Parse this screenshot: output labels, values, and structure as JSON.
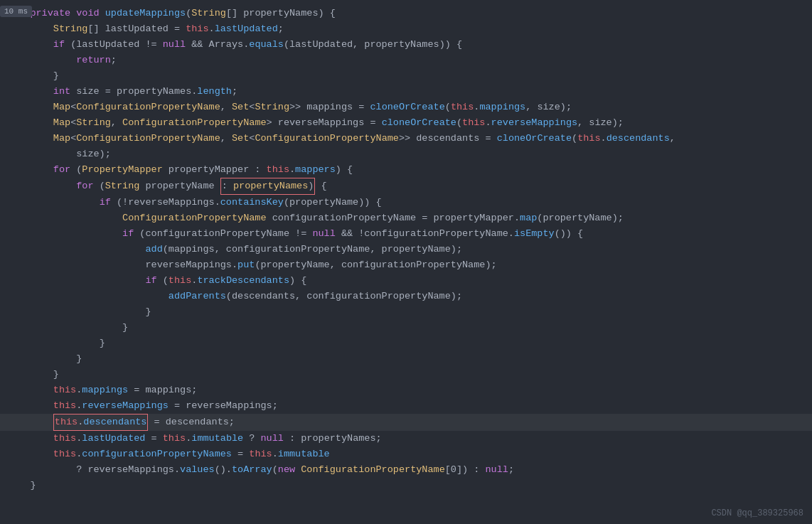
{
  "timer": "10 ms",
  "watermark": "CSDN @qq_389325968",
  "lines": [
    {
      "indent": 1,
      "tokens": [
        {
          "t": "kw",
          "v": "private "
        },
        {
          "t": "kw",
          "v": "void "
        },
        {
          "t": "fn",
          "v": "updateMappings"
        },
        {
          "t": "plain",
          "v": "("
        },
        {
          "t": "type",
          "v": "String"
        },
        {
          "t": "plain",
          "v": "[] propertyNames) {"
        }
      ]
    },
    {
      "indent": 2,
      "tokens": [
        {
          "t": "type",
          "v": "String"
        },
        {
          "t": "plain",
          "v": "[] lastUpdated = "
        },
        {
          "t": "this",
          "v": "this"
        },
        {
          "t": "plain",
          "v": "."
        },
        {
          "t": "prop",
          "v": "lastUpdated"
        },
        {
          "t": "plain",
          "v": ";"
        }
      ]
    },
    {
      "indent": 2,
      "tokens": [
        {
          "t": "kw",
          "v": "if "
        },
        {
          "t": "plain",
          "v": "(lastUpdated != "
        },
        {
          "t": "kw",
          "v": "null "
        },
        {
          "t": "plain",
          "v": "&& Arrays."
        },
        {
          "t": "fn",
          "v": "equals"
        },
        {
          "t": "plain",
          "v": "(lastUpdated, propertyNames)) {"
        }
      ]
    },
    {
      "indent": 3,
      "tokens": [
        {
          "t": "kw",
          "v": "return"
        },
        {
          "t": "plain",
          "v": ";"
        }
      ]
    },
    {
      "indent": 2,
      "tokens": [
        {
          "t": "plain",
          "v": "}"
        }
      ]
    },
    {
      "indent": 2,
      "tokens": [
        {
          "t": "kw",
          "v": "int "
        },
        {
          "t": "plain",
          "v": "size = propertyNames."
        },
        {
          "t": "prop",
          "v": "length"
        },
        {
          "t": "plain",
          "v": ";"
        }
      ]
    },
    {
      "indent": 2,
      "tokens": [
        {
          "t": "type",
          "v": "Map"
        },
        {
          "t": "plain",
          "v": "<"
        },
        {
          "t": "type",
          "v": "ConfigurationPropertyName"
        },
        {
          "t": "plain",
          "v": ", "
        },
        {
          "t": "type",
          "v": "Set"
        },
        {
          "t": "plain",
          "v": "<"
        },
        {
          "t": "type",
          "v": "String"
        },
        {
          "t": "plain",
          "v": ">> mappings = "
        },
        {
          "t": "fn",
          "v": "cloneOrCreate"
        },
        {
          "t": "plain",
          "v": "("
        },
        {
          "t": "this",
          "v": "this"
        },
        {
          "t": "plain",
          "v": "."
        },
        {
          "t": "prop",
          "v": "mappings"
        },
        {
          "t": "plain",
          "v": ", size);"
        }
      ]
    },
    {
      "indent": 2,
      "tokens": [
        {
          "t": "type",
          "v": "Map"
        },
        {
          "t": "plain",
          "v": "<"
        },
        {
          "t": "type",
          "v": "String"
        },
        {
          "t": "plain",
          "v": ", "
        },
        {
          "t": "type",
          "v": "ConfigurationPropertyName"
        },
        {
          "t": "plain",
          "v": "> reverseMappings = "
        },
        {
          "t": "fn",
          "v": "cloneOrCreate"
        },
        {
          "t": "plain",
          "v": "("
        },
        {
          "t": "this",
          "v": "this"
        },
        {
          "t": "plain",
          "v": "."
        },
        {
          "t": "prop",
          "v": "reverseMappings"
        },
        {
          "t": "plain",
          "v": ", size);"
        }
      ]
    },
    {
      "indent": 2,
      "tokens": [
        {
          "t": "type",
          "v": "Map"
        },
        {
          "t": "plain",
          "v": "<"
        },
        {
          "t": "type",
          "v": "ConfigurationPropertyName"
        },
        {
          "t": "plain",
          "v": ", "
        },
        {
          "t": "type",
          "v": "Set"
        },
        {
          "t": "plain",
          "v": "<"
        },
        {
          "t": "type",
          "v": "ConfigurationPropertyName"
        },
        {
          "t": "plain",
          "v": ">> descendants = "
        },
        {
          "t": "fn",
          "v": "cloneOrCreate"
        },
        {
          "t": "plain",
          "v": "("
        },
        {
          "t": "this",
          "v": "this"
        },
        {
          "t": "plain",
          "v": "."
        },
        {
          "t": "prop",
          "v": "descendants"
        },
        {
          "t": "plain",
          "v": ","
        }
      ]
    },
    {
      "indent": 3,
      "tokens": [
        {
          "t": "plain",
          "v": "size);"
        }
      ]
    },
    {
      "indent": 2,
      "tokens": [
        {
          "t": "kw",
          "v": "for "
        },
        {
          "t": "plain",
          "v": "("
        },
        {
          "t": "type",
          "v": "PropertyMapper"
        },
        {
          "t": "plain",
          "v": " propertyMapper : "
        },
        {
          "t": "this",
          "v": "this"
        },
        {
          "t": "plain",
          "v": "."
        },
        {
          "t": "prop",
          "v": "mappers"
        },
        {
          "t": "plain",
          "v": ") {"
        }
      ]
    },
    {
      "indent": 3,
      "tokens": [
        {
          "t": "kw",
          "v": "for "
        },
        {
          "t": "plain",
          "v": "("
        },
        {
          "t": "type",
          "v": "String"
        },
        {
          "t": "plain",
          "v": " propertyName "
        },
        {
          "t": "redbox",
          "v": ": propertyNames)"
        },
        {
          "t": "plain",
          "v": " {"
        }
      ]
    },
    {
      "indent": 4,
      "tokens": [
        {
          "t": "kw",
          "v": "if "
        },
        {
          "t": "plain",
          "v": "(!reverseMappings."
        },
        {
          "t": "fn",
          "v": "containsKey"
        },
        {
          "t": "plain",
          "v": "(propertyName)) {"
        }
      ]
    },
    {
      "indent": 5,
      "tokens": [
        {
          "t": "type",
          "v": "ConfigurationPropertyName"
        },
        {
          "t": "plain",
          "v": " configurationPropertyName = propertyMapper."
        },
        {
          "t": "fn",
          "v": "map"
        },
        {
          "t": "plain",
          "v": "(propertyName);"
        }
      ]
    },
    {
      "indent": 5,
      "tokens": [
        {
          "t": "kw",
          "v": "if "
        },
        {
          "t": "plain",
          "v": "(configurationPropertyName != "
        },
        {
          "t": "kw",
          "v": "null "
        },
        {
          "t": "plain",
          "v": "&& !configurationPropertyName."
        },
        {
          "t": "fn",
          "v": "isEmpty"
        },
        {
          "t": "plain",
          "v": "()) {"
        }
      ]
    },
    {
      "indent": 6,
      "tokens": [
        {
          "t": "fn",
          "v": "add"
        },
        {
          "t": "plain",
          "v": "(mappings, configurationPropertyName, propertyName);"
        }
      ]
    },
    {
      "indent": 6,
      "tokens": [
        {
          "t": "plain",
          "v": "reverseMappings."
        },
        {
          "t": "fn",
          "v": "put"
        },
        {
          "t": "plain",
          "v": "(propertyName, configurationPropertyName);"
        }
      ]
    },
    {
      "indent": 6,
      "tokens": [
        {
          "t": "kw",
          "v": "if "
        },
        {
          "t": "plain",
          "v": "("
        },
        {
          "t": "this",
          "v": "this"
        },
        {
          "t": "plain",
          "v": "."
        },
        {
          "t": "prop",
          "v": "trackDescendants"
        },
        {
          "t": "plain",
          "v": ") {"
        }
      ]
    },
    {
      "indent": 7,
      "tokens": [
        {
          "t": "fn",
          "v": "addParents"
        },
        {
          "t": "plain",
          "v": "(descendants, configurationPropertyName);"
        }
      ]
    },
    {
      "indent": 6,
      "tokens": [
        {
          "t": "plain",
          "v": "}"
        }
      ]
    },
    {
      "indent": 5,
      "tokens": [
        {
          "t": "plain",
          "v": "}"
        }
      ]
    },
    {
      "indent": 4,
      "tokens": [
        {
          "t": "plain",
          "v": "}"
        }
      ]
    },
    {
      "indent": 3,
      "tokens": [
        {
          "t": "plain",
          "v": "}"
        }
      ]
    },
    {
      "indent": 2,
      "tokens": [
        {
          "t": "plain",
          "v": "}"
        }
      ]
    },
    {
      "indent": 2,
      "tokens": [
        {
          "t": "this",
          "v": "this"
        },
        {
          "t": "plain",
          "v": "."
        },
        {
          "t": "prop",
          "v": "mappings"
        },
        {
          "t": "plain",
          "v": " = mappings;"
        }
      ]
    },
    {
      "indent": 2,
      "tokens": [
        {
          "t": "this",
          "v": "this"
        },
        {
          "t": "plain",
          "v": "."
        },
        {
          "t": "prop",
          "v": "reverseMappings"
        },
        {
          "t": "plain",
          "v": " = reverseMappings;"
        }
      ]
    },
    {
      "indent": 2,
      "tokens": [
        {
          "t": "redbox2",
          "v": "this.descendants"
        },
        {
          "t": "plain",
          "v": " = descendants;"
        }
      ],
      "highlighted": true
    },
    {
      "indent": 2,
      "tokens": [
        {
          "t": "this",
          "v": "this"
        },
        {
          "t": "plain",
          "v": "."
        },
        {
          "t": "prop",
          "v": "lastUpdated"
        },
        {
          "t": "plain",
          "v": " = "
        },
        {
          "t": "this",
          "v": "this"
        },
        {
          "t": "plain",
          "v": "."
        },
        {
          "t": "prop",
          "v": "immutable"
        },
        {
          "t": "plain",
          "v": " ? "
        },
        {
          "t": "kw",
          "v": "null "
        },
        {
          "t": "plain",
          "v": ": propertyNames;"
        }
      ]
    },
    {
      "indent": 2,
      "tokens": [
        {
          "t": "this",
          "v": "this"
        },
        {
          "t": "plain",
          "v": "."
        },
        {
          "t": "prop",
          "v": "configurationPropertyNames"
        },
        {
          "t": "plain",
          "v": " = "
        },
        {
          "t": "this",
          "v": "this"
        },
        {
          "t": "plain",
          "v": "."
        },
        {
          "t": "prop",
          "v": "immutable"
        }
      ]
    },
    {
      "indent": 3,
      "tokens": [
        {
          "t": "plain",
          "v": "? reverseMappings."
        },
        {
          "t": "fn",
          "v": "values"
        },
        {
          "t": "plain",
          "v": "()."
        },
        {
          "t": "fn",
          "v": "toArray"
        },
        {
          "t": "plain",
          "v": "("
        },
        {
          "t": "kw",
          "v": "new "
        },
        {
          "t": "type",
          "v": "ConfigurationPropertyName"
        },
        {
          "t": "plain",
          "v": "[0]) : "
        },
        {
          "t": "kw",
          "v": "null"
        },
        {
          "t": "plain",
          "v": ";"
        }
      ]
    },
    {
      "indent": 1,
      "tokens": [
        {
          "t": "plain",
          "v": "}"
        }
      ]
    }
  ]
}
